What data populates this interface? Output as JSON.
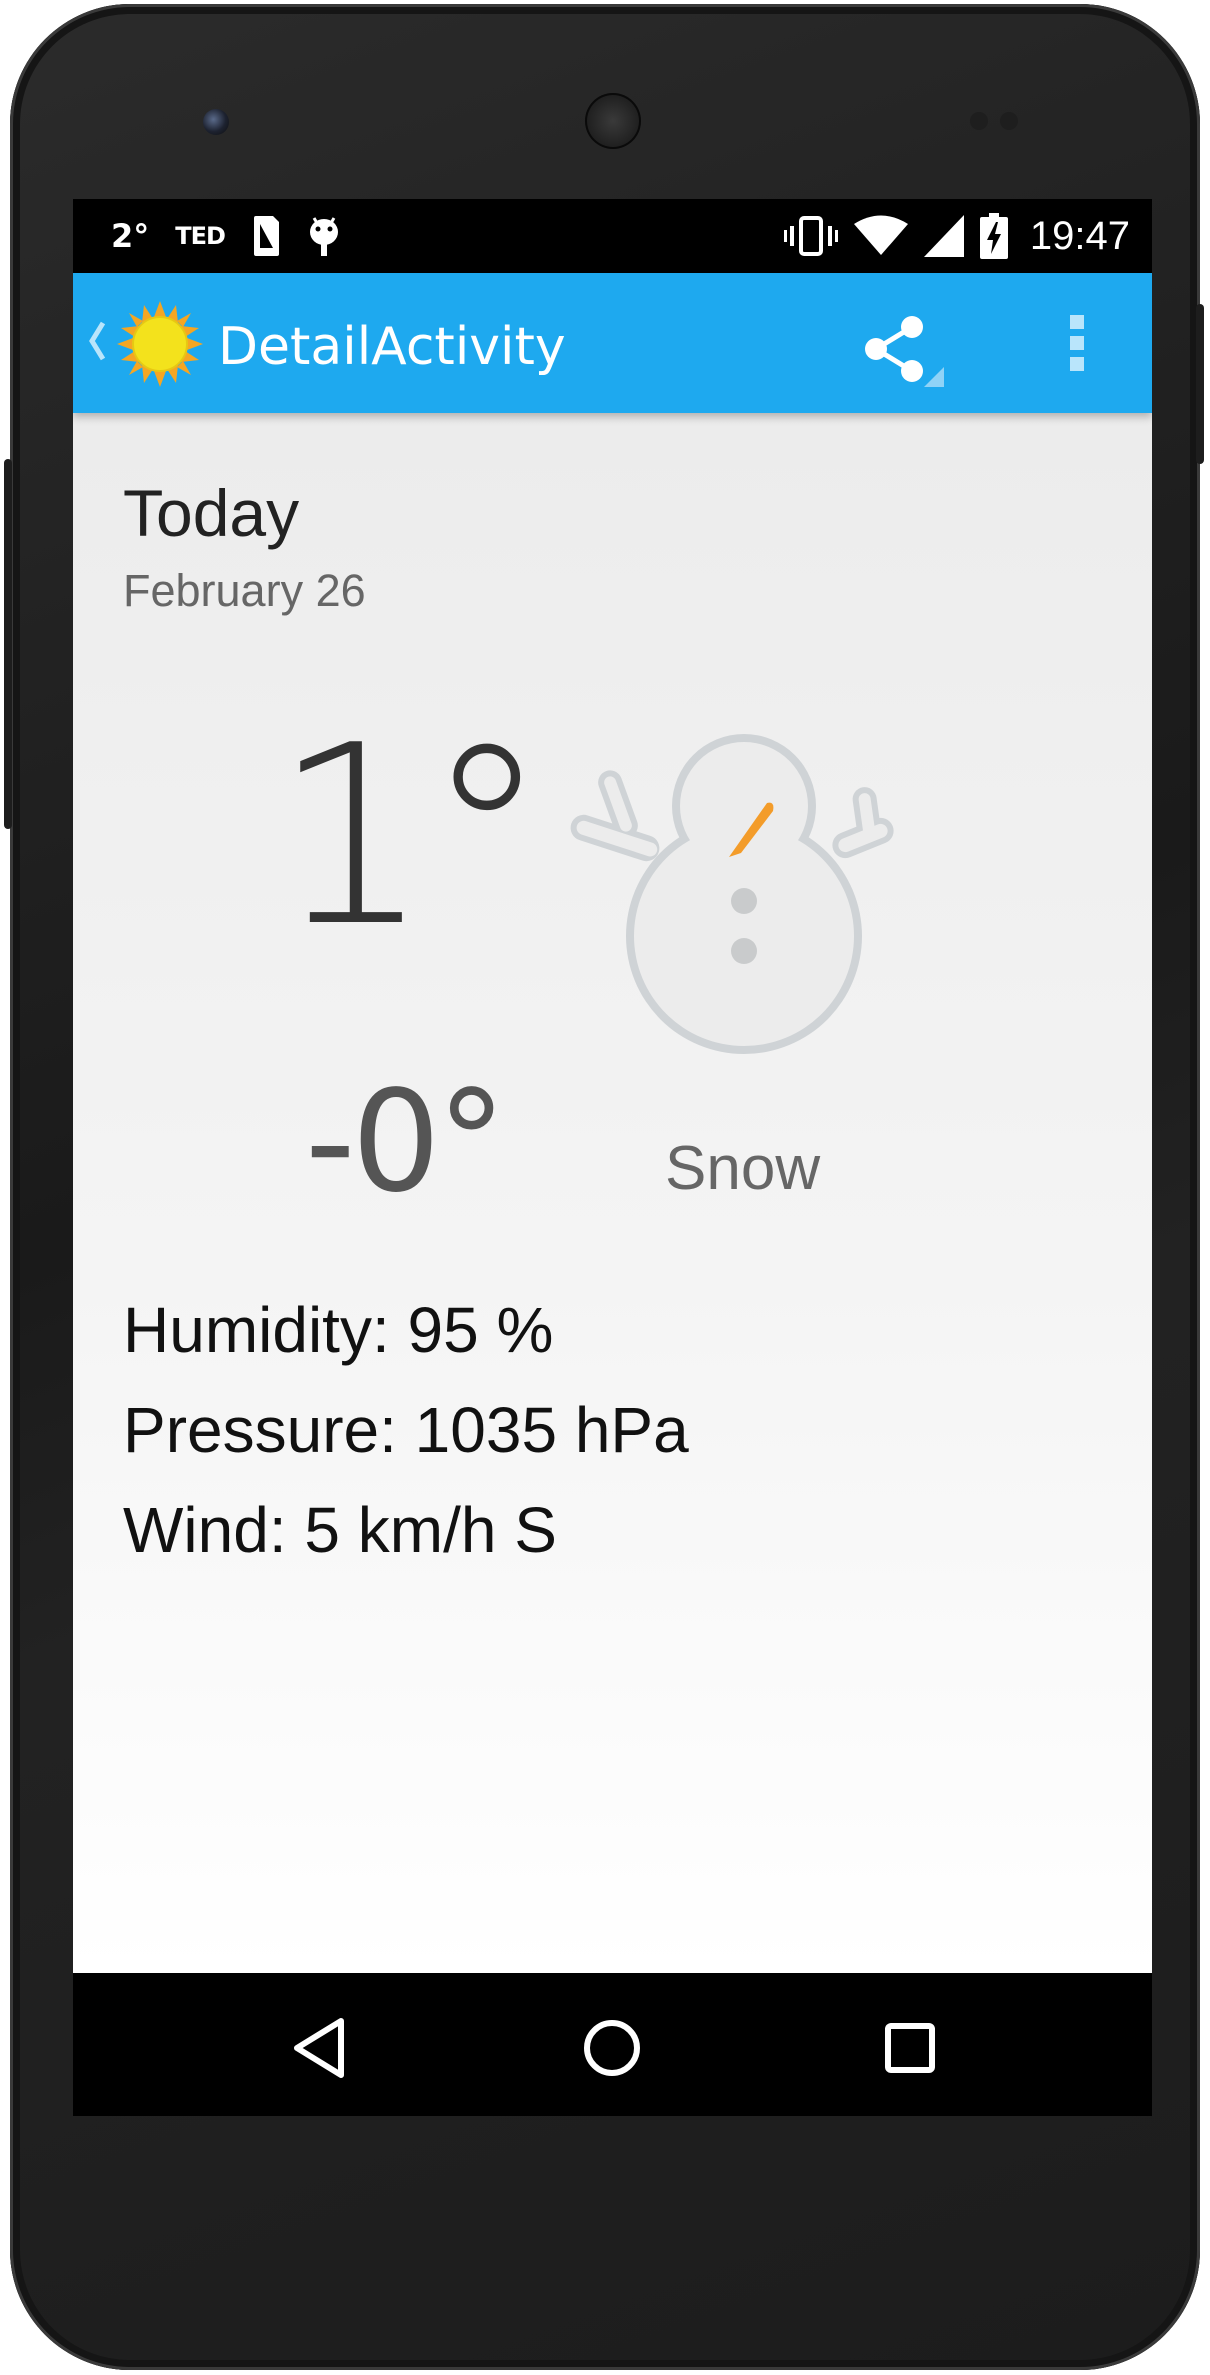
{
  "status_bar": {
    "notification_temp": "2°",
    "notification_app": "TED",
    "notification_icons": [
      "sim-card-icon",
      "android-icon"
    ],
    "system_icons": [
      "vibrate-icon",
      "wifi-icon",
      "signal-icon",
      "battery-charging-icon"
    ],
    "time": "19:47"
  },
  "action_bar": {
    "title": "DetailActivity",
    "background_color": "#1ea9ef",
    "icons": [
      "up-chevron-icon",
      "sun-logo-icon",
      "share-icon",
      "overflow-menu-icon"
    ]
  },
  "detail": {
    "day": "Today",
    "date": "February 26",
    "high": "1°",
    "low": "-0°",
    "condition_icon": "snowman-icon",
    "description": "Snow",
    "humidity": "Humidity: 95 %",
    "pressure": "Pressure: 1035 hPa",
    "wind": "Wind: 5 km/h S"
  },
  "nav_bar": {
    "icons": [
      "back-icon",
      "home-icon",
      "recents-icon"
    ]
  }
}
